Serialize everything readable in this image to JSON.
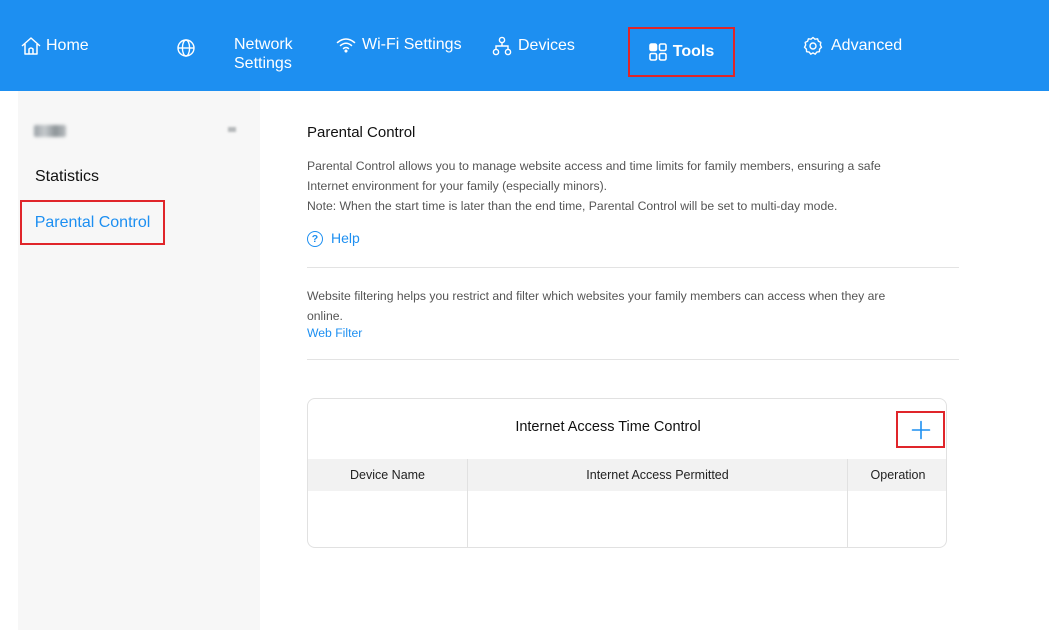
{
  "nav": {
    "home": "Home",
    "network_line1": "Network",
    "network_line2": "Settings",
    "wifi": "Wi-Fi Settings",
    "devices": "Devices",
    "tools": "Tools",
    "advanced": "Advanced"
  },
  "sidebar": {
    "items": [
      {
        "label": "Statistics"
      },
      {
        "label": "Parental Control"
      }
    ]
  },
  "main": {
    "title": "Parental Control",
    "desc_line1": "Parental Control allows you to manage website access and time limits for family members, ensuring a safe",
    "desc_line2": "Internet environment for your family (especially minors).",
    "desc_line3": "Note: When the start time is later than the end time, Parental Control will be set to multi-day mode.",
    "help": "Help",
    "help_icon": "?",
    "webfilter_desc_line1": "Website filtering helps you restrict and filter which websites your family members can access when they are",
    "webfilter_desc_line2": "online.",
    "webfilter_link": "Web Filter"
  },
  "time_control": {
    "title": "Internet Access Time Control",
    "columns": [
      "Device Name",
      "Internet Access Permitted",
      "Operation"
    ],
    "rows": []
  },
  "colors": {
    "brand": "#1d8ff1",
    "highlight": "#e0252a"
  }
}
